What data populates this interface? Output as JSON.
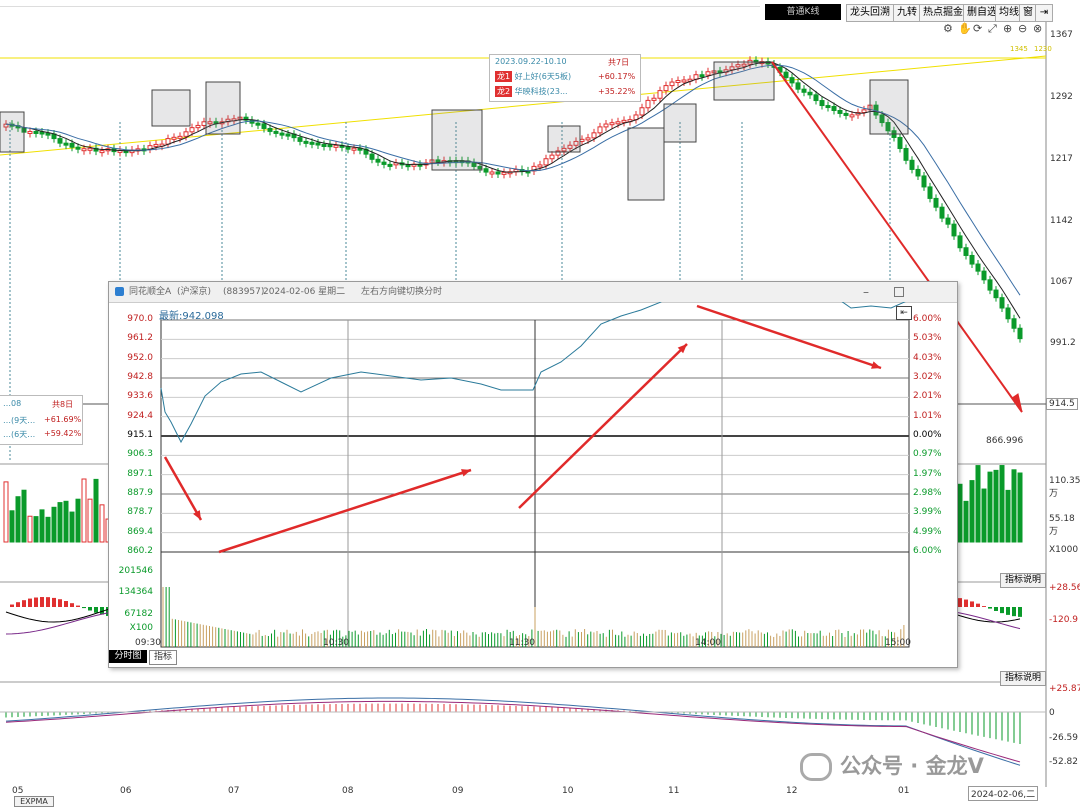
{
  "toolbar": {
    "kline_type": "普通K线",
    "buttons": [
      "龙头回溯",
      "九转",
      "热点掘金",
      "删自选",
      "均线",
      "窗"
    ]
  },
  "main_chart": {
    "price_axis": [
      "1367",
      "1292",
      "1217",
      "1142",
      "1067",
      "991.2",
      "914.5",
      "866.996"
    ],
    "date_axis": [
      "05",
      "06",
      "07",
      "08",
      "09",
      "10",
      "11",
      "12",
      "01",
      "2024-02-06,二"
    ],
    "volume_axis": [
      "110.35万",
      "55.18万",
      "X1000"
    ],
    "indicator1_axis": [
      "+28.56",
      "-120.9"
    ],
    "indicator2_axis": [
      "+25.87",
      "0",
      "-26.59",
      "-52.82"
    ],
    "indicator_button": "指标说明",
    "bottom_tab": "EXPMA",
    "line_labels": [
      "1345",
      "1230"
    ]
  },
  "info_box_top": {
    "range": "2023.09.22-10.10",
    "total": "共7日",
    "rows": [
      {
        "tag": "龙1",
        "name": "好上好(6天5板)",
        "change": "+60.17%"
      },
      {
        "tag": "龙2",
        "name": "华映科技(23...",
        "change": "+35.22%"
      }
    ]
  },
  "info_box_left": {
    "range": "…08",
    "total": "共8日",
    "rows": [
      {
        "name": "…(9天…",
        "change": "+61.69%"
      },
      {
        "name": "…(6天…",
        "change": "+59.42%"
      }
    ]
  },
  "popup": {
    "title_name": "同花顺全A",
    "title_market": "(沪深京)",
    "title_code": "(883957)",
    "title_date": "2024-02-06 星期二",
    "title_hint": "左右方向键切换分时",
    "latest_label": "最新:",
    "latest_value": "942.098",
    "price_axis": [
      "970.0",
      "961.2",
      "952.0",
      "942.8",
      "933.6",
      "924.4",
      "915.1",
      "906.3",
      "897.1",
      "887.9",
      "878.7",
      "869.4",
      "860.2"
    ],
    "pct_axis": [
      "6.00%",
      "5.03%",
      "4.03%",
      "3.02%",
      "2.01%",
      "1.01%",
      "0.00%",
      "0.97%",
      "1.97%",
      "2.98%",
      "3.99%",
      "4.99%",
      "6.00%"
    ],
    "volume_axis": [
      "201546",
      "134364",
      "67182",
      "X100"
    ],
    "time_axis": [
      "09:30",
      "10:30",
      "11:30",
      "14:00",
      "15:00"
    ],
    "tabs": [
      "分时图",
      "指标"
    ]
  },
  "watermark": "公众号 · 金龙V",
  "colors": {
    "up": "#e03030",
    "down": "#0a9a2a",
    "ma5": "#222222",
    "ma10": "#3a6ea5",
    "price_line": "#2a7a9a",
    "arrow": "#e02a2a",
    "yellow": "#f0e000"
  }
}
